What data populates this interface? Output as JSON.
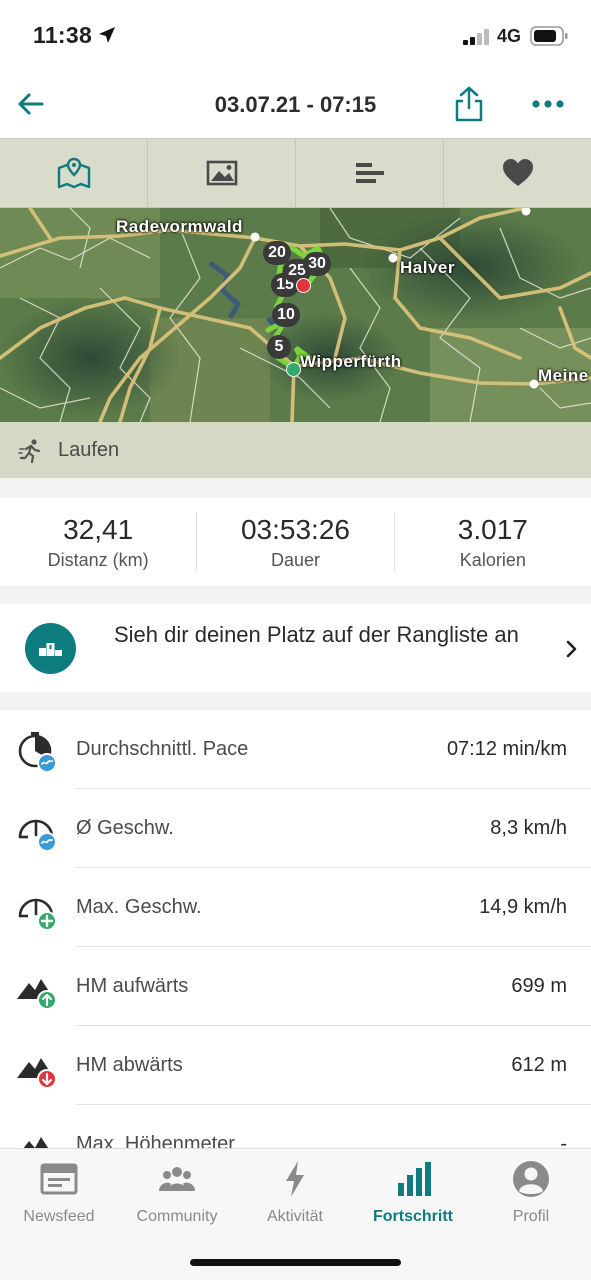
{
  "status_bar": {
    "time": "11:38",
    "network": "4G"
  },
  "header": {
    "title": "03.07.21 - 07:15"
  },
  "tabs": [
    {
      "icon": "map-icon"
    },
    {
      "icon": "image-icon"
    },
    {
      "icon": "bar-list-icon"
    },
    {
      "icon": "heart-icon"
    }
  ],
  "map": {
    "places": [
      "Radevormwald",
      "Halver",
      "Wipperfürth",
      "Meine"
    ],
    "markers": [
      "5",
      "10",
      "15",
      "20",
      "25",
      "30"
    ]
  },
  "sport": {
    "label": "Laufen"
  },
  "summary": [
    {
      "value": "32,41",
      "label": "Distanz (km)"
    },
    {
      "value": "03:53:26",
      "label": "Dauer"
    },
    {
      "value": "3.017",
      "label": "Kalorien"
    }
  ],
  "leaderboard": {
    "text": "Sieh dir deinen Platz auf der Rangliste an"
  },
  "stats": [
    {
      "label": "Durchschnittl. Pace",
      "value": "07:12 min/km",
      "icon": "stopwatch-avg-icon"
    },
    {
      "label": "Ø Geschw.",
      "value": "8,3 km/h",
      "icon": "speedometer-avg-icon"
    },
    {
      "label": "Max. Geschw.",
      "value": "14,9 km/h",
      "icon": "speedometer-max-icon"
    },
    {
      "label": "HM aufwärts",
      "value": "699 m",
      "icon": "elevation-up-icon"
    },
    {
      "label": "HM abwärts",
      "value": "612 m",
      "icon": "elevation-down-icon"
    },
    {
      "label": "Max. Höhenmeter",
      "value": "-",
      "icon": "elevation-max-icon"
    }
  ],
  "bottom_nav": [
    {
      "label": "Newsfeed",
      "active": false
    },
    {
      "label": "Community",
      "active": false
    },
    {
      "label": "Aktivität",
      "active": false
    },
    {
      "label": "Fortschritt",
      "active": true
    },
    {
      "label": "Profil",
      "active": false
    }
  ],
  "colors": {
    "accent": "#0e7b7e",
    "start": "#35a86b",
    "finish": "#e0353f",
    "route": "#7bd43b"
  }
}
